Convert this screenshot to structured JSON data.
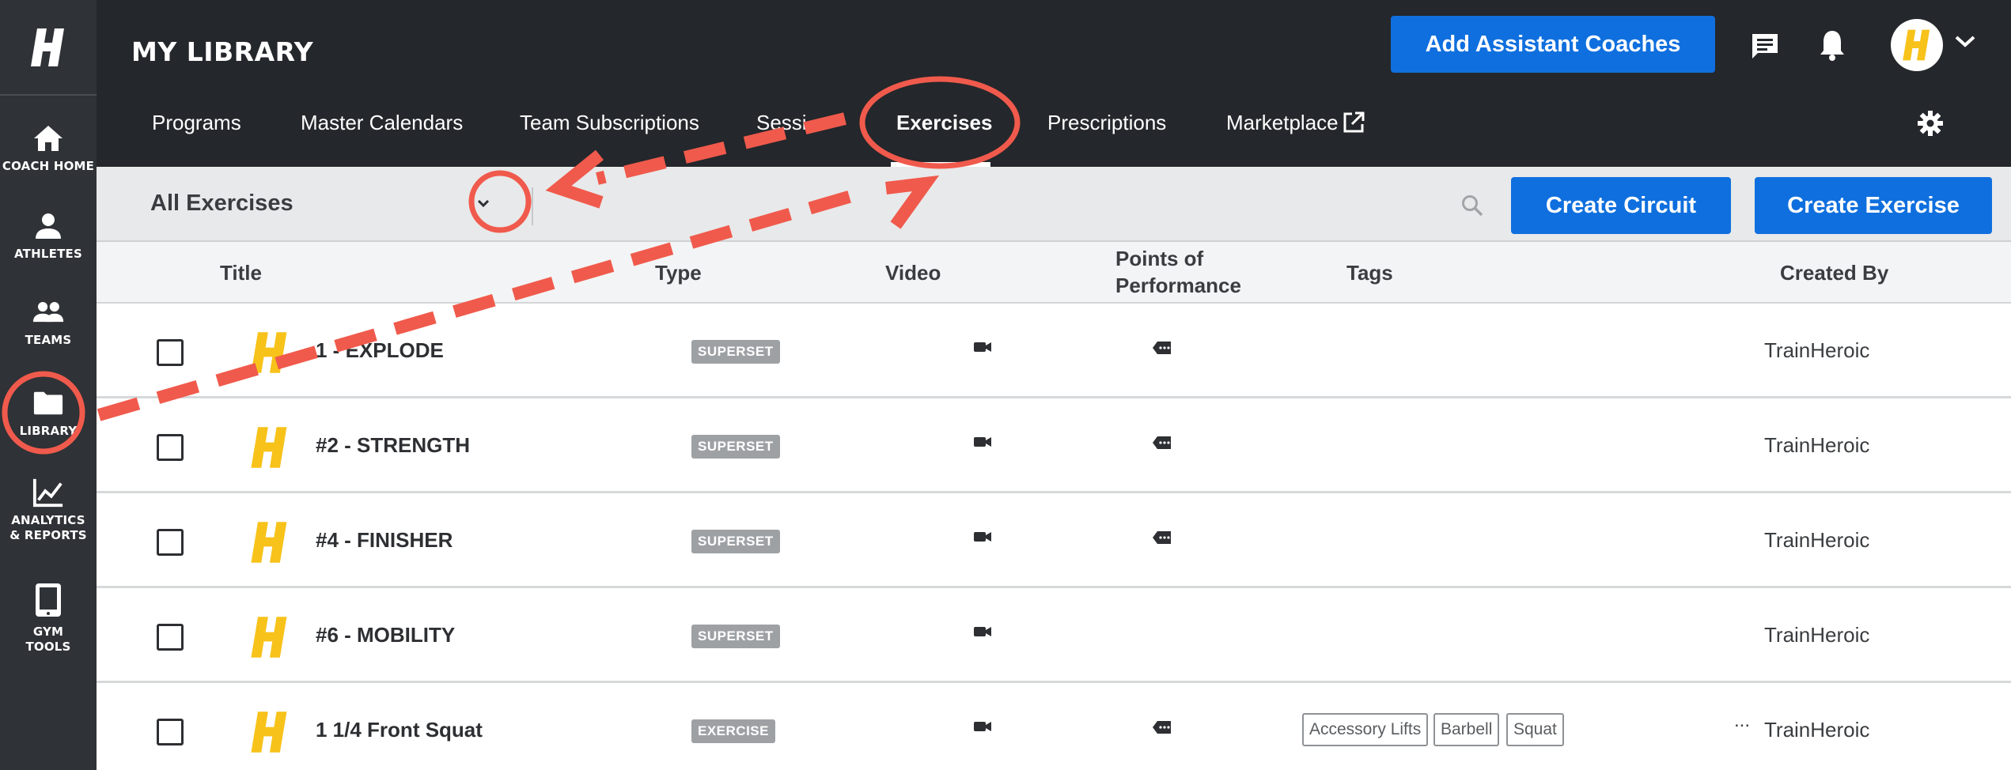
{
  "sidebar": {
    "items": [
      {
        "label": "COACH HOME",
        "icon": "home-icon"
      },
      {
        "label": "ATHLETES",
        "icon": "person-icon"
      },
      {
        "label": "TEAMS",
        "icon": "people-icon"
      },
      {
        "label": "LIBRARY",
        "icon": "folder-icon"
      },
      {
        "label": "ANALYTICS & REPORTS",
        "icon": "chart-icon"
      },
      {
        "label": "GYM TOOLS",
        "icon": "tablet-icon"
      }
    ]
  },
  "header": {
    "title": "MY LIBRARY",
    "add_coaches_label": "Add Assistant Coaches",
    "tabs": [
      {
        "label": "Programs"
      },
      {
        "label": "Master Calendars"
      },
      {
        "label": "Team Subscriptions"
      },
      {
        "label": "Sessi"
      },
      {
        "label": "Exercises"
      },
      {
        "label": "Prescriptions"
      },
      {
        "label": "Marketplace"
      }
    ]
  },
  "toolbar": {
    "filter_label": "All Exercises",
    "create_circuit_label": "Create Circuit",
    "create_exercise_label": "Create Exercise"
  },
  "table": {
    "headers": {
      "title": "Title",
      "type": "Type",
      "video": "Video",
      "pop_line1": "Points of",
      "pop_line2": "Performance",
      "tags": "Tags",
      "created_by": "Created By"
    },
    "rows": [
      {
        "title": "1 - EXPLODE",
        "type": "SUPERSET",
        "created_by": "TrainHeroic"
      },
      {
        "title": "#2 - STRENGTH",
        "type": "SUPERSET",
        "created_by": "TrainHeroic"
      },
      {
        "title": "#4 - FINISHER",
        "type": "SUPERSET",
        "created_by": "TrainHeroic"
      },
      {
        "title": "#6 - MOBILITY",
        "type": "SUPERSET",
        "created_by": "TrainHeroic"
      },
      {
        "title": "1 1/4 Front Squat",
        "type": "EXERCISE",
        "created_by": "TrainHeroic",
        "tags": [
          "Accessory Lifts",
          "Barbell",
          "Squat"
        ],
        "more": "..."
      }
    ]
  },
  "colors": {
    "accent": "#0f6fde",
    "sidebar": "#2f3236",
    "header": "#24272b",
    "brand_yellow": "#f7c21a",
    "annotation": "#f05a4c"
  }
}
